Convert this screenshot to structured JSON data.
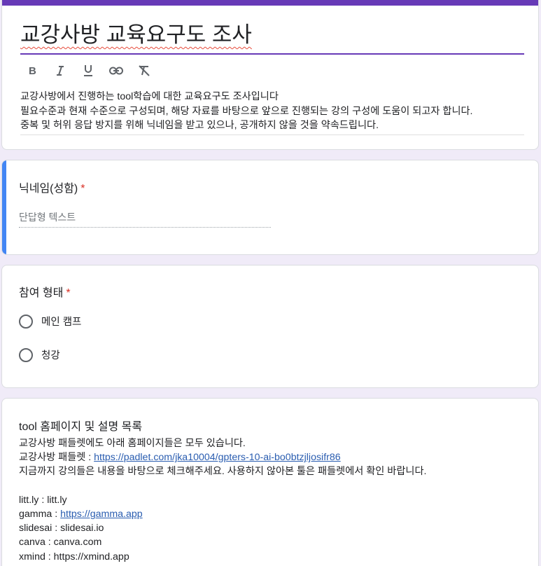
{
  "header": {
    "title": "교강사방 교육요구도 조사",
    "toolbar": {
      "bold": "B",
      "italic": "I",
      "underline": "U"
    },
    "description": [
      "교강사방에서 진행하는 tool학습에 대한 교육요구도 조사입니다",
      "필요수준과 현재 수준으로 구성되며, 해당 자료를 바탕으로 앞으로 진행되는 강의 구성에 도움이 되고자 합니다.",
      "중복 및 허위 응답 방지를 위해 닉네임을 받고 있으나, 공개하지 않을 것을 약속드립니다."
    ]
  },
  "questions": [
    {
      "title": "닉네임(성함)",
      "required_mark": "*",
      "placeholder": "단답형 텍스트"
    },
    {
      "title": "참여 형태",
      "required_mark": "*",
      "options": [
        "메인 캠프",
        "청강"
      ]
    },
    {
      "title": "tool 홈페이지 및 설명 목록",
      "lines": {
        "intro": " 교강사방 패들렛에도 아래 홈페이지들은 모두 있습니다.",
        "padlet_prefix": "교강사방 패들렛 : ",
        "padlet_link": "https://padlet.com/jka10004/gpters-10-ai-bo0btzjljosifr86",
        "instruction": "지금까지 강의들은 내용을 바탕으로 체크해주세요. 사용하지 않아본 툴은 패들렛에서 확인 바랍니다.",
        "littly": "litt.ly :  litt.ly",
        "gamma_prefix": "gamma : ",
        "gamma_link": "https://gamma.app",
        "slidesai": "slidesai : slidesai.io",
        "canva": "canva : canva.com",
        "xmind": "xmind : https://xmind.app"
      }
    }
  ],
  "colors": {
    "theme": "#673ab7",
    "active_indicator": "#4285f4",
    "required": "#d93025",
    "background": "#f0ebf8"
  }
}
